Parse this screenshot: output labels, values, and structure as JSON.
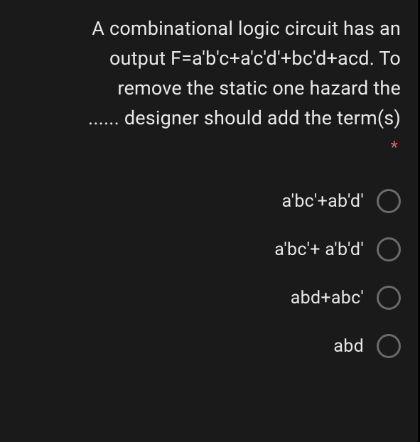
{
  "question": {
    "line1": "A combinational logic circuit has an",
    "line2": "output F=a'b'c+a'c'd'+bc'd+acd. To",
    "line3": "remove the static one hazard the",
    "line4": "...... designer should add the term(s)",
    "required_mark": "*"
  },
  "options": [
    {
      "label": "a'bc'+ab'd'"
    },
    {
      "label": "a'bc'+ a'b'd'"
    },
    {
      "label": "abd+abc'"
    },
    {
      "label": "abd"
    }
  ]
}
